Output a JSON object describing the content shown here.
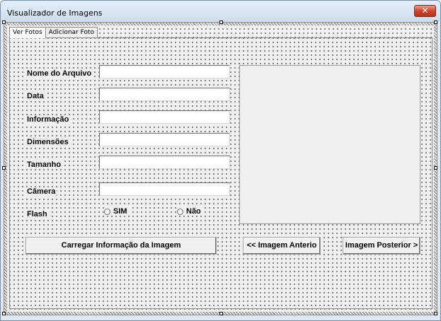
{
  "window": {
    "title": "Visualizador de Imagens",
    "close_label": "✕"
  },
  "tabs": [
    {
      "label": "Ver Fotos",
      "active": true
    },
    {
      "label": "Adicionar Foto",
      "active": false
    }
  ],
  "fields": {
    "nome_arquivo": {
      "label": "Nome do Arquivo",
      "value": ""
    },
    "data": {
      "label": "Data",
      "value": ""
    },
    "informacao": {
      "label": "Informação",
      "value": ""
    },
    "dimensoes": {
      "label": "Dimensões",
      "value": ""
    },
    "tamanho": {
      "label": "Tamanho",
      "value": ""
    },
    "camera": {
      "label": "Câmera",
      "value": ""
    }
  },
  "flash": {
    "label": "Flash",
    "options": [
      "SIM",
      "Não"
    ]
  },
  "buttons": {
    "carregar": "Carregar Informação da Imagem",
    "anterior": "<< Imagem Anterio",
    "posterior": "Imagem Posterior >"
  }
}
